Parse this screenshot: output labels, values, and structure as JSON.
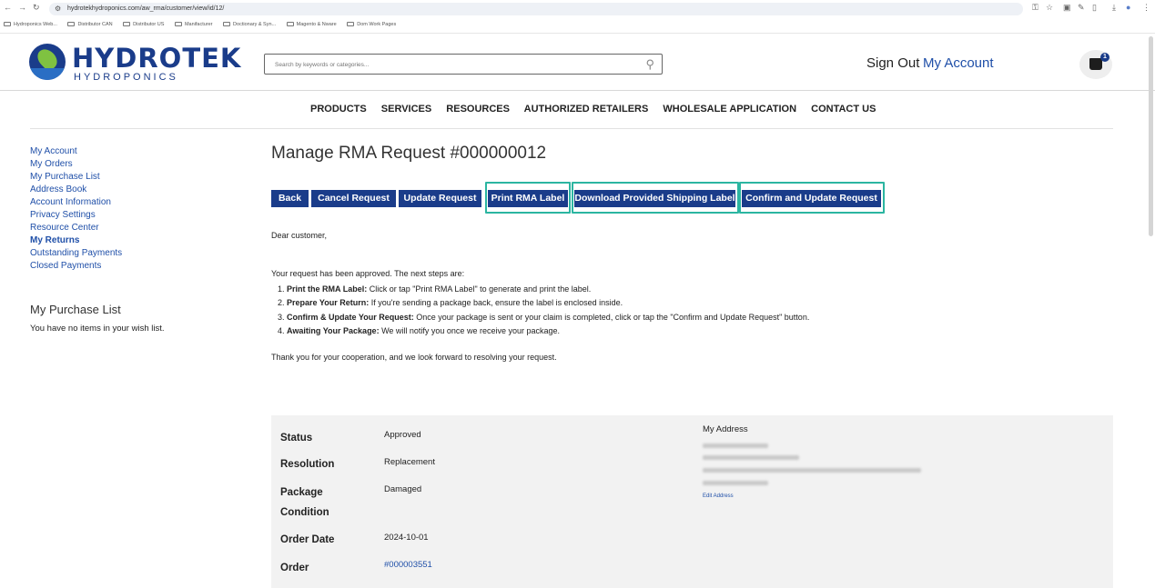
{
  "browser": {
    "url": "hydrotekhydroponics.com/aw_rma/customer/view/id/12/",
    "bookmarks": [
      "Hydroponics Web...",
      "Distributor CAN",
      "Distributor US",
      "Manifacturer",
      "Doctionary & Syn...",
      "Magento & Nware",
      "Dom Work Pages"
    ]
  },
  "header": {
    "logo_name": "HYDROTEK",
    "logo_sub": "HYDROPONICS",
    "search_placeholder": "Search by keywords or categories...",
    "sign_out": "Sign Out",
    "my_account": "My Account",
    "cart_count": "1"
  },
  "nav": [
    "PRODUCTS",
    "SERVICES",
    "RESOURCES",
    "AUTHORIZED RETAILERS",
    "WHOLESALE APPLICATION",
    "CONTACT US"
  ],
  "sidebar": {
    "items": [
      "My Account",
      "My Orders",
      "My Purchase List",
      "Address Book",
      "Account Information",
      "Privacy Settings",
      "Resource Center",
      "My Returns",
      "Outstanding Payments",
      "Closed Payments"
    ],
    "wishlist_title": "My Purchase List",
    "wishlist_text": "You have no items in your wish list."
  },
  "main": {
    "title": "Manage RMA Request #000000012",
    "buttons": {
      "back": "Back",
      "cancel": "Cancel Request",
      "update": "Update Request",
      "print": "Print RMA Label",
      "download": "Download Provided Shipping Label",
      "confirm": "Confirm and Update Request"
    },
    "greeting": "Dear customer,",
    "intro": "Your request has been approved. The next steps are:",
    "steps": [
      {
        "n": "1.",
        "bold": "Print the RMA Label:",
        "text": " Click or tap \"Print RMA Label\" to generate and print the label."
      },
      {
        "n": "2.",
        "bold": "Prepare Your Return:",
        "text": " If you're sending a package back, ensure the label is enclosed inside."
      },
      {
        "n": "3.",
        "bold": "Confirm & Update Your Request:",
        "text": " Once your package is sent or your claim is completed, click or tap the \"Confirm and Update Request\" button."
      },
      {
        "n": "4.",
        "bold": "Awaiting Your Package:",
        "text": " We will notify you once we receive your package."
      }
    ],
    "closing": "Thank you for your cooperation, and we look forward to resolving your request."
  },
  "details": {
    "status_label": "Status",
    "status_value": "Approved",
    "resolution_label": "Resolution",
    "resolution_value": "Replacement",
    "condition_label_1": "Package",
    "condition_label_2": "Condition",
    "condition_value": "Damaged",
    "order_date_label": "Order Date",
    "order_date_value": "2024-10-01",
    "order_label": "Order",
    "order_value": "#000003551",
    "address_title": "My Address",
    "edit_address": "Edit Address"
  }
}
